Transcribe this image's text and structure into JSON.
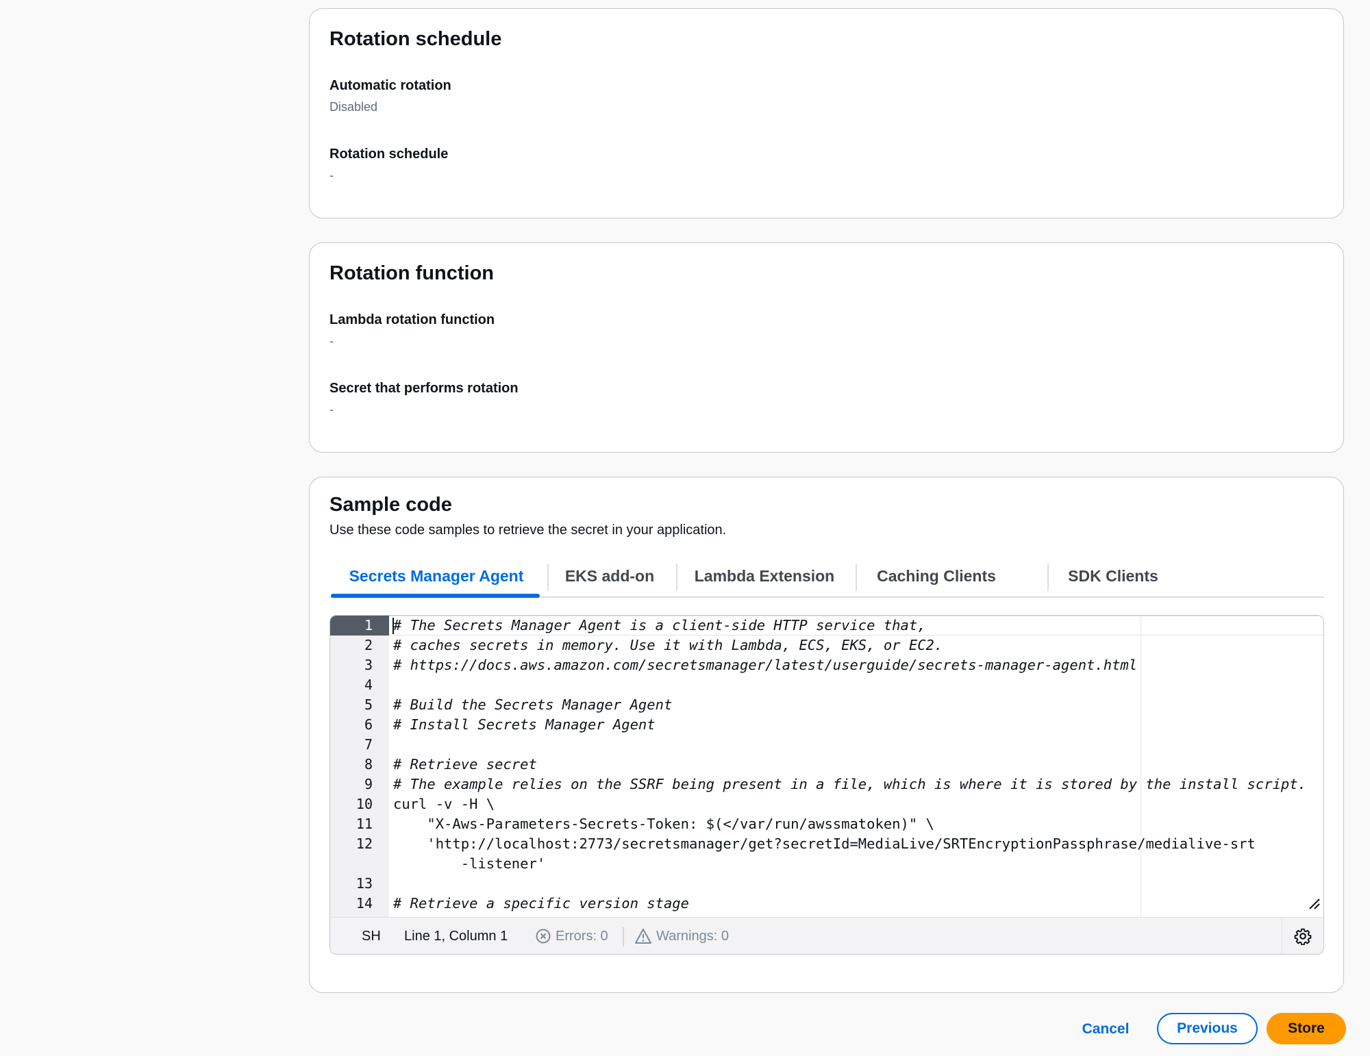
{
  "rotation_schedule": {
    "title": "Rotation schedule",
    "automatic_rotation_label": "Automatic rotation",
    "automatic_rotation_value": "Disabled",
    "schedule_label": "Rotation schedule",
    "schedule_value": "-"
  },
  "rotation_function": {
    "title": "Rotation function",
    "lambda_label": "Lambda rotation function",
    "lambda_value": "-",
    "secret_label": "Secret that performs rotation",
    "secret_value": "-"
  },
  "sample_code": {
    "title": "Sample code",
    "description": "Use these code samples to retrieve the secret in your application.",
    "tabs": [
      {
        "label": "Secrets Manager Agent",
        "active": true
      },
      {
        "label": "EKS add-on",
        "active": false
      },
      {
        "label": "Lambda Extension",
        "active": false
      },
      {
        "label": "Caching Clients",
        "active": false
      },
      {
        "label": "SDK Clients",
        "active": false
      }
    ],
    "editor": {
      "line_numbers": [
        "1",
        "2",
        "3",
        "4",
        "5",
        "6",
        "7",
        "8",
        "9",
        "10",
        "11",
        "12",
        "13",
        "14"
      ],
      "lines": [
        "# The Secrets Manager Agent is a client-side HTTP service that,",
        "# caches secrets in memory. Use it with Lambda, ECS, EKS, or EC2.",
        "# https://docs.aws.amazon.com/secretsmanager/latest/userguide/secrets-manager-agent.html",
        "",
        "# Build the Secrets Manager Agent",
        "# Install Secrets Manager Agent",
        "",
        "# Retrieve secret",
        "# The example relies on the SSRF being present in a file, which is where it is stored by the install script.",
        "curl -v -H \\",
        "    \"X-Aws-Parameters-Secrets-Token: $(</var/run/awssmatoken)\" \\",
        "    'http://localhost:2773/secretsmanager/get?secretId=MediaLive/SRTEncryptionPassphrase/medialive-srt",
        "        -listener'",
        "",
        "# Retrieve a specific version stage"
      ],
      "status": {
        "language": "SH",
        "position": "Line 1, Column 1",
        "errors": "Errors: 0",
        "warnings": "Warnings: 0"
      }
    }
  },
  "footer": {
    "cancel_label": "Cancel",
    "previous_label": "Previous",
    "store_label": "Store"
  },
  "colors": {
    "accent": "#006ce0",
    "primary_button": "#ff9900"
  }
}
